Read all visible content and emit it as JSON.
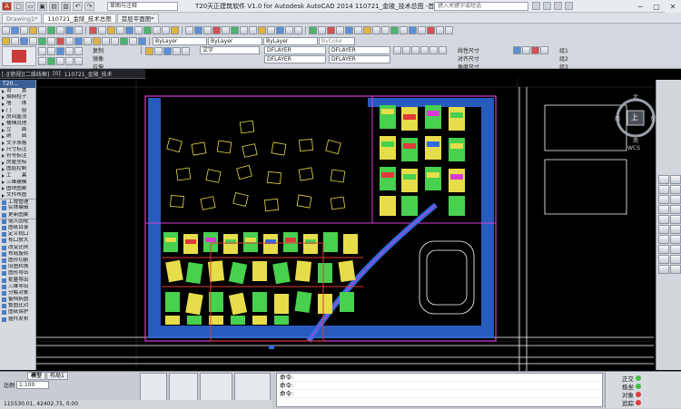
{
  "app": {
    "title": "T20天正建筑软件 V1.0 for Autodesk AutoCAD 2014    110721_金陵_技术总图 -首层平面图.dwg",
    "workspace": "草图与注释",
    "help_search_placeholder": "键入关键字或短语"
  },
  "doc_tabs": [
    {
      "label": "Drawing1*"
    },
    {
      "label": "110721_金陵_技术总图"
    },
    {
      "label": "首层平面图*"
    }
  ],
  "ribbon": {
    "layer_combo_1": "ByLayer",
    "layer_combo_2": "ByLayer",
    "layer_combo_3": "ByLayer",
    "color_combo": "ByColor",
    "text_style_1": "文字",
    "layer_name_1": "DFLAYER",
    "layer_name_2": "DFLAYER",
    "layer_name_3": "DFLAYER",
    "layer_name_4": "DFLAYER",
    "label_copy": "复制",
    "label_mirror": "镜像",
    "label_stretch": "拉伸",
    "label_dim_1": "线性尺寸",
    "label_dim_2": "对齐尺寸",
    "label_dim_3": "角度尺寸",
    "label_group1": "组1",
    "label_group2": "组2",
    "label_group3": "组3"
  },
  "viewport_tab": {
    "label_1": "[-][俯视][二维线框]",
    "label_2": "[0]",
    "label_3": "110721_金陵_技术"
  },
  "palette": {
    "title": "T20...",
    "items": [
      "设　　置",
      "轴网柱子",
      "墙　　体",
      "门　　窗",
      "房间屋顶",
      "楼梯其他",
      "立　　面",
      "剖　　面",
      "文字表格",
      "尺寸标注",
      "符号标注",
      "房屋坐标",
      "图层控制",
      "工　　具",
      "三维建模",
      "图块图案",
      "文件布图",
      "工程管理",
      "实体编辑",
      "更新图案",
      "插入图框",
      "图纸目录",
      "定义视口",
      "视口放大",
      "改变比例",
      "布局旋转",
      "图形切割",
      "旧图转换",
      "图形导出",
      "批量导出",
      "三维导出",
      "分解对象",
      "备档拆图",
      "整图比对",
      "图纸保护",
      "插件发布"
    ]
  },
  "compass": {
    "north": "北",
    "west": "西",
    "east": "东",
    "south": "南",
    "top_label": "上",
    "wcs": "WCS"
  },
  "model_tabs": [
    {
      "label": "模型"
    },
    {
      "label": "布局1"
    }
  ],
  "scale": {
    "label": "比例",
    "value": "1:100",
    "coord": "115530.01, 42402.75, 0.00"
  },
  "command": {
    "lines": [
      "命令:",
      "命令:",
      "命令:"
    ]
  },
  "snap": {
    "ortho": "正交",
    "polar": "极坐",
    "object": "对象",
    "track": "追踪",
    "ortho_label": "基线",
    "fill_label": "填充"
  },
  "colors": {
    "wall": "#d93bd2",
    "building_yellow": "#e7dc4a",
    "building_green": "#48d04f",
    "building_red": "#e03a3a",
    "hatch_blue": "#2f6be0",
    "road_white": "#ffffff",
    "bg": "#000000"
  }
}
